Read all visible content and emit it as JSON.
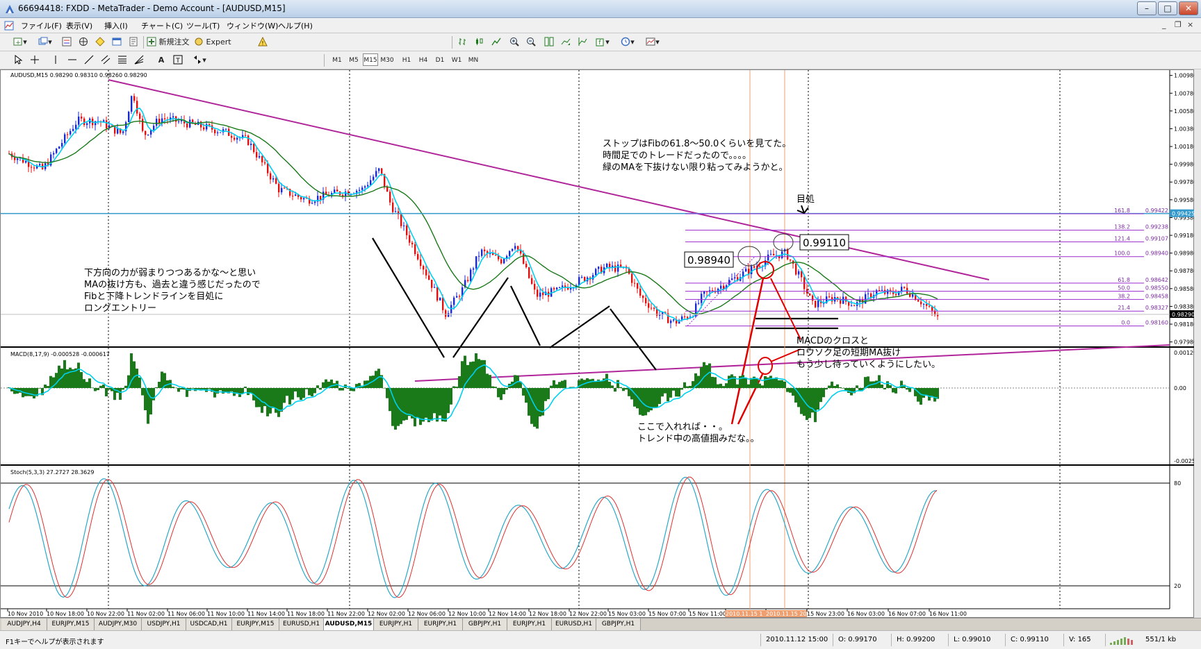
{
  "window": {
    "title": "66694418: FXDD - MetaTrader - Demo Account - [AUDUSD,M15]",
    "controls": {
      "minimize": "–",
      "maximize": "□",
      "close": "✕",
      "mdi_minimize": "_",
      "mdi_restore": "❐",
      "mdi_close": "×"
    }
  },
  "menu": [
    "ファイル(F)",
    "表示(V)",
    "挿入(I)",
    "チャート(C)",
    "ツール(T)",
    "ウィンドウ(W)",
    "ヘルプ(H)"
  ],
  "toolbar": {
    "new_order_label": "新規注文",
    "expert_advisors_label": "Expert Advisors",
    "timeframes": [
      "M1",
      "M5",
      "M15",
      "M30",
      "H1",
      "H4",
      "D1",
      "W1",
      "MN"
    ],
    "active_timeframe": "M15"
  },
  "chart": {
    "symbol_header": "AUDUSD,M15  0.98290 0.98310 0.98260 0.98290",
    "price_axis": [
      "1.00980",
      "1.00780",
      "1.00580",
      "1.00380",
      "1.00180",
      "0.99980",
      "0.99780",
      "0.99580",
      "0.99380",
      "0.99180",
      "0.98980",
      "0.98780",
      "0.98580",
      "0.98380",
      "0.98180",
      "0.97980"
    ],
    "current_price": "0.98290",
    "horizontal_line_price": "0.99425",
    "fib_levels": [
      {
        "label": "161.8",
        "price": "0.99422"
      },
      {
        "label": "138.2",
        "price": "0.99238"
      },
      {
        "label": "121.4",
        "price": "0.99107"
      },
      {
        "label": "100.0",
        "price": "0.98940"
      },
      {
        "label": "61.8",
        "price": "0.98642"
      },
      {
        "label": "50.0",
        "price": "0.98550"
      },
      {
        "label": "38.2",
        "price": "0.98458"
      },
      {
        "label": "21.4",
        "price": "0.98327"
      },
      {
        "label": "0.0",
        "price": "0.98160"
      }
    ],
    "price_boxes": [
      "0.98940",
      "0.99110"
    ],
    "annotations": {
      "left_note": [
        "下方向の力が弱まりつつあるかな〜と思い",
        "MAの抜け方も、過去と違う感じだったので",
        "Fibと下降トレンドラインを目処に",
        "ロングエントリー"
      ],
      "top_note": [
        "ストップはFibの61.8〜50.0くらいを見てた。",
        "時間足でのトレードだったので。。。。",
        "緑のMAを下抜けない限り粘ってみようかと。"
      ],
      "target_label": "目処",
      "macd_note": [
        "MACDのクロスと",
        "ロウソク足の短期MA抜け",
        "もう少し待っていくようにしたい。"
      ],
      "entry_note": [
        "ここで入れれば・・。",
        "トレンド中の高値掴みだな。。"
      ]
    },
    "macd": {
      "header": "MACD(8,17,9) -0.000528 -0.000617",
      "axis": [
        "0.001291",
        "0.00",
        "-0.00258"
      ]
    },
    "stoch": {
      "header": "Stoch(5,3,3) 27.2727 28.3629",
      "axis": [
        "80",
        "20"
      ]
    },
    "time_axis": [
      "10 Nov 2010",
      "10 Nov 18:00",
      "10 Nov 22:00",
      "11 Nov 02:00",
      "11 Nov 06:00",
      "11 Nov 10:00",
      "11 Nov 14:00",
      "11 Nov 18:00",
      "11 Nov 22:00",
      "12 Nov 02:00",
      "12 Nov 06:00",
      "12 Nov 10:00",
      "12 Nov 14:00",
      "12 Nov 18:00",
      "12 Nov 22:00",
      "15 Nov 03:00",
      "15 Nov 07:00",
      "15 Nov 11:00",
      "2010.11.15 1",
      "2010.11.15 20:30",
      "15 Nov 23:00",
      "16 Nov 03:00",
      "16 Nov 07:00",
      "16 Nov 11:00"
    ]
  },
  "symbol_tabs": [
    "AUDJPY,H4",
    "EURJPY,M15",
    "AUDJPY,M30",
    "USDJPY,H1",
    "USDCAD,H1",
    "EURJPY,M15",
    "EURUSD,H1",
    "AUDUSD,M15",
    "EURJPY,H1",
    "EURJPY,H1",
    "GBPJPY,H1",
    "EURJPY,H1",
    "EURUSD,H1",
    "GBPJPY,H1"
  ],
  "active_symbol_tab": 7,
  "status": {
    "help": "F1キーでヘルプが表示されます",
    "datetime": "2010.11.12 15:00",
    "open": "O: 0.99170",
    "high": "H: 0.99200",
    "low": "L: 0.99010",
    "close": "C: 0.99110",
    "volume": "V: 165",
    "traffic": "551/1 kb"
  },
  "colors": {
    "bull": "#1a2acc",
    "bear": "#e01010",
    "ma_fast": "#00d0f0",
    "ma_slow": "#1a7a1a",
    "trend": "#b0259a",
    "fib": "#9a2ad0",
    "hline": "#3399cc",
    "macd_hist": "#1a7a1a",
    "macd_signal": "#00d0f0",
    "annot": "#e00000"
  }
}
